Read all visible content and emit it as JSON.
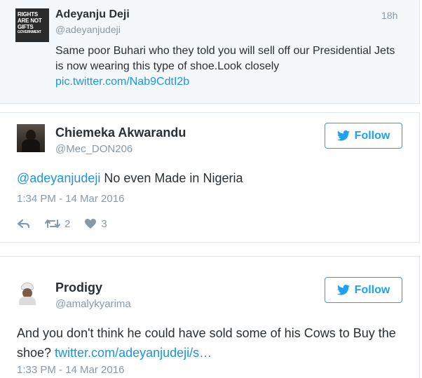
{
  "parent_tweet": {
    "avatar_text": [
      "RIGHTS",
      "ARE NOT",
      "GIFTS"
    ],
    "avatar_subtext": "GOVERNMENT",
    "author_name": "Adeyanju Deji",
    "author_handle": "@adeyanjudeji",
    "time_ago": "18h",
    "text": "Same poor Buhari who they told you will sell off our Presidential Jets is now wearing this type of shoe.Look closely",
    "link": "pic.twitter.com/Nab9CdtI2b"
  },
  "reply_tweet": {
    "author_name": "Chiemeka Akwarandu",
    "author_handle": "@Mec_DON206",
    "mention": "@adeyanjudeji",
    "text": " No even Made in Nigeria",
    "timestamp": "1:34 PM - 14 Mar 2016",
    "follow_label": "Follow",
    "retweet_count": "2",
    "like_count": "3"
  },
  "second_reply": {
    "author_name": "Prodigy",
    "author_handle": "@amalykyarima",
    "text": "And you don't think he could have sold some of his Cows to Buy the shoe? ",
    "link": "twitter.com/adeyanjudeji/s…",
    "timestamp": "1:33 PM - 14 Mar 2016",
    "follow_label": "Follow"
  },
  "colors": {
    "accent": "#1da1f2",
    "link": "#1b95e0",
    "muted": "#8899a6",
    "text": "#292f33",
    "parent_bg": "#f5f8fa"
  },
  "icons": {
    "reply": "reply-arrow-icon",
    "retweet": "retweet-icon",
    "like": "heart-icon",
    "follow": "twitter-bird-icon"
  }
}
